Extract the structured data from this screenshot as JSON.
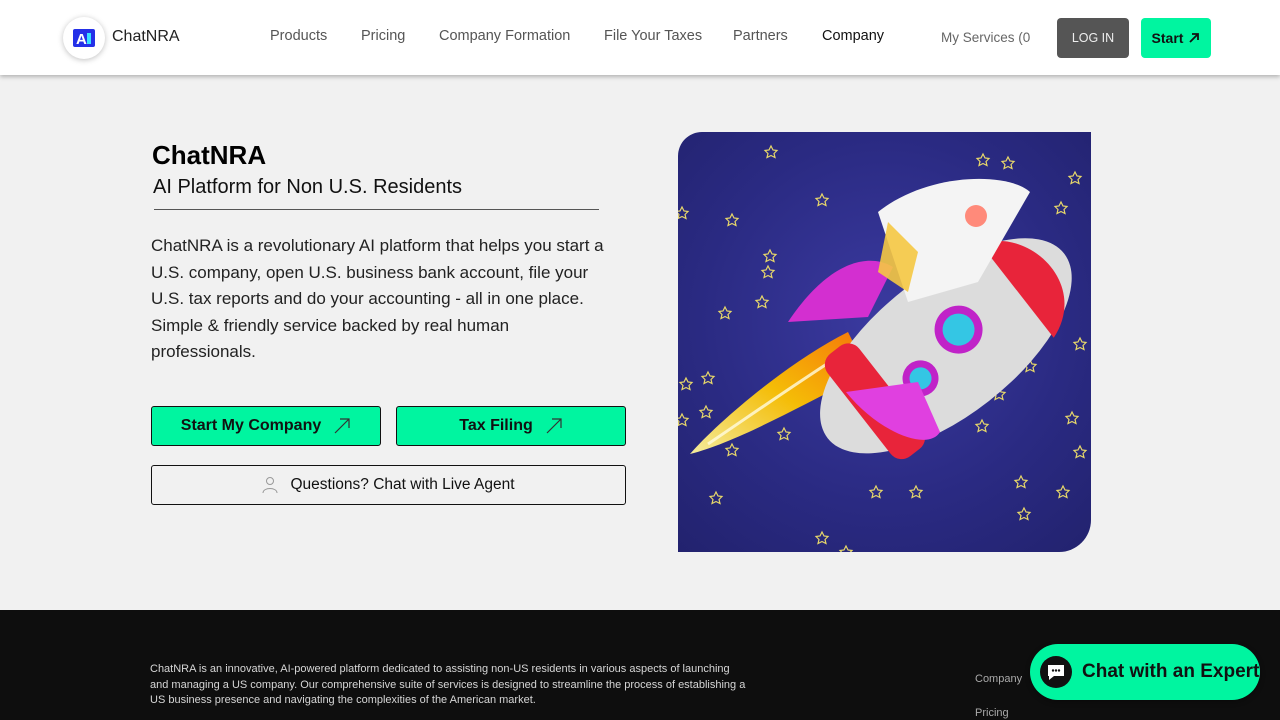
{
  "header": {
    "brand": "ChatNRA",
    "nav": [
      "Products",
      "Pricing",
      "Company Formation",
      "File Your Taxes",
      "Partners",
      "Company"
    ],
    "active_nav": "Company",
    "my_services": "My Services (0",
    "login": "LOG IN",
    "start": "Start"
  },
  "hero": {
    "title": "ChatNRA",
    "subtitle": "AI Platform for Non U.S. Residents",
    "description": "ChatNRA is a revolutionary AI platform that helps you start a U.S. company, open U.S. business bank account, file your U.S. tax reports and do your accounting - all in one place. Simple & friendly service backed by real human professionals.",
    "btn_start_company": "Start My Company",
    "btn_tax_filing": "Tax Filing",
    "btn_chat_agent": "Questions? Chat with Live Agent",
    "image_alt": "rocket-illustration"
  },
  "footer": {
    "about": "ChatNRA is an innovative, AI-powered platform dedicated to assisting non-US residents in various aspects of launching and managing a US company. Our comprehensive suite of services is designed to streamline the process of establishing a US business presence and navigating the complexities of the American market.",
    "links": [
      "Company",
      "Pricing"
    ]
  },
  "chat_widget": {
    "label": "Chat with an Expert"
  },
  "colors": {
    "accent": "#00f5a0",
    "login_bg": "#555555",
    "footer_bg": "#0e0e0e",
    "hero_image_bg": "#2a2a82"
  }
}
